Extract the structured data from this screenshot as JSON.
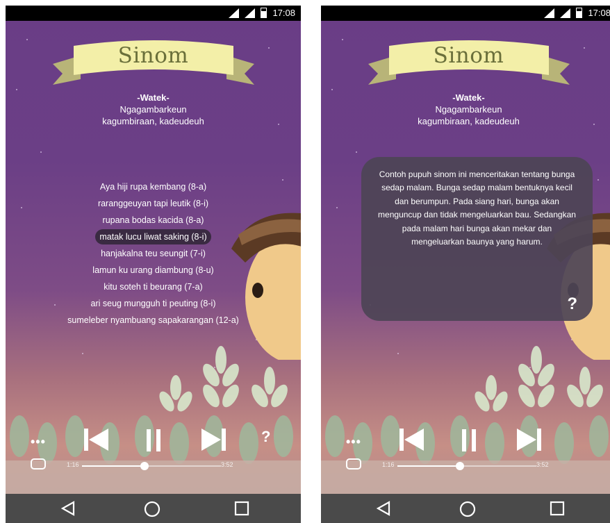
{
  "status_bar": {
    "time": "17:08"
  },
  "banner": {
    "title": "Sinom"
  },
  "watek": {
    "heading": "-Watek-",
    "line1": "Ngagambarkeun",
    "line2": "kagumbiraan, kadeudeuh"
  },
  "poem": {
    "lines": [
      "Aya hiji rupa kembang (8-a)",
      "raranggeuyan tapi leutik (8-i)",
      "rupana bodas kacida (8-a)",
      "matak lucu liwat saking (8-i)",
      "hanjakalna teu seungit (7-i)",
      "lamun ku urang diambung (8-u)",
      "kitu soteh ti beurang (7-a)",
      "ari seug mungguh ti peuting (8-i)",
      "sumeleber nyambuang sapakarangan (12-a)"
    ],
    "highlighted_index": 3
  },
  "info_box": {
    "text": "Contoh pupuh sinom ini menceritakan tentang bunga sedap malam. Bunga sedap malam bentuknya kecil dan berumpun. Pada siang hari, bunga akan menguncup dan tidak mengeluarkan bau. Sedangkan pada malam hari bunga akan mekar dan mengeluarkan baunya yang harum.",
    "help_label": "?"
  },
  "player": {
    "more_label": "•••",
    "help_label": "?",
    "elapsed": "1:16",
    "total": "3:52",
    "progress": 0.45
  },
  "colors": {
    "accent": "#f3efa8",
    "sky_top": "#6a3d86",
    "sky_bottom": "#c68f86",
    "nav": "#4a4a4a"
  },
  "icons": [
    "signal-icon",
    "signal-x-icon",
    "battery-icon",
    "more-icon",
    "previous-icon",
    "pause-icon",
    "next-icon",
    "help-icon",
    "repeat-icon",
    "back-icon",
    "home-icon",
    "recents-icon"
  ]
}
